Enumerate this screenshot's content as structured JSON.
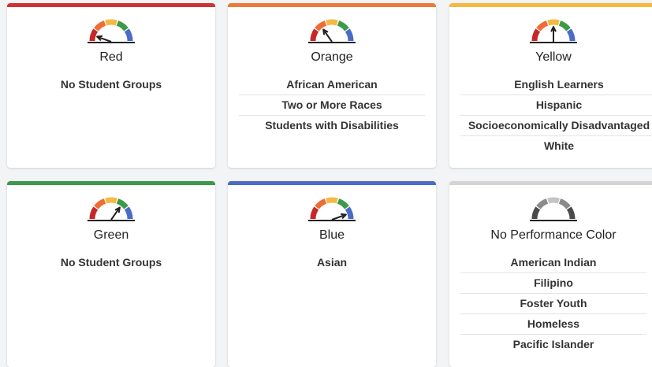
{
  "cards": [
    {
      "title": "Red",
      "accent": "#cf3232",
      "needle": "red",
      "empty_label": "No Student Groups",
      "groups": []
    },
    {
      "title": "Orange",
      "accent": "#ec7a3a",
      "needle": "orange",
      "empty_label": "",
      "groups": [
        "African American",
        "Two or More Races",
        "Students with Disabilities"
      ]
    },
    {
      "title": "Yellow",
      "accent": "#f5b942",
      "needle": "yellow",
      "empty_label": "",
      "groups": [
        "English Learners",
        "Hispanic",
        "Socioeconomically Disadvantaged",
        "White"
      ]
    },
    {
      "title": "Green",
      "accent": "#3a9a4a",
      "needle": "green",
      "empty_label": "No Student Groups",
      "groups": []
    },
    {
      "title": "Blue",
      "accent": "#4a6cc7",
      "needle": "blue",
      "empty_label": "",
      "groups": [
        "Asian"
      ]
    },
    {
      "title": "No Performance Color",
      "accent": "#d4d4d4",
      "needle": "none",
      "empty_label": "",
      "groups": [
        "American Indian",
        "Filipino",
        "Foster Youth",
        "Homeless",
        "Pacific Islander"
      ]
    }
  ],
  "gauge_colors": {
    "red": "#c62828",
    "orange": "#ef6c34",
    "yellow": "#f5b942",
    "green": "#3c9a48",
    "blue": "#4a6cc7",
    "gray_dark": "#4a4a4a",
    "gray_mid": "#8a8a8a",
    "gray_light": "#c4c4c4"
  },
  "icons": {
    "gauge": "performance-gauge-icon"
  }
}
